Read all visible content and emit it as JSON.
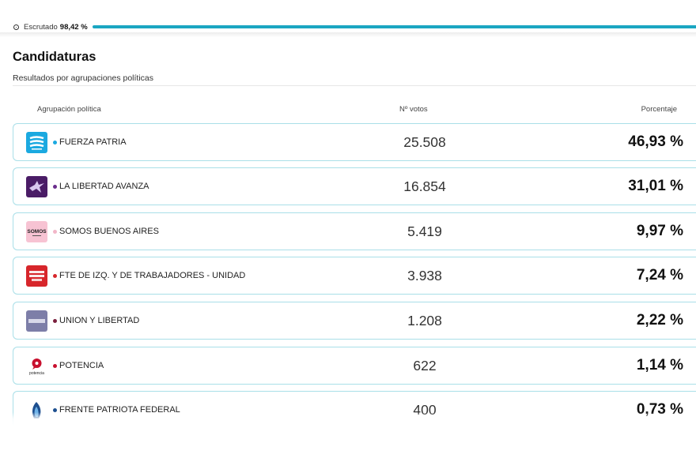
{
  "progress": {
    "label": "Escrutado",
    "value": "98,42 %",
    "fraction": 0.9842
  },
  "section": {
    "title": "Candidaturas",
    "subtitle": "Resultados por agrupaciones políticas"
  },
  "table": {
    "headers": {
      "party": "Agrupación política",
      "votes": "Nº votos",
      "percent": "Porcentaje"
    },
    "rows": [
      {
        "name": "FUERZA PATRIA",
        "votes": "25.508",
        "percent": "46,93 %",
        "color": "#1ba9e0",
        "logo_icon": "fuerza-patria-logo"
      },
      {
        "name": "LA LIBERTAD AVANZA",
        "votes": "16.854",
        "percent": "31,01 %",
        "color": "#6a2d8c",
        "logo_icon": "la-libertad-avanza-logo"
      },
      {
        "name": "SOMOS BUENOS AIRES",
        "votes": "5.419",
        "percent": "9,97 %",
        "color": "#f2b6c8",
        "logo_icon": "somos-logo",
        "logo_text": "SOMOS"
      },
      {
        "name": "FTE DE IZQ. Y DE TRABAJADORES - UNIDAD",
        "votes": "3.938",
        "percent": "7,24 %",
        "color": "#d7262b",
        "logo_icon": "fit-unidad-logo"
      },
      {
        "name": "UNION Y LIBERTAD",
        "votes": "1.208",
        "percent": "2,22 %",
        "color": "#7a1f3d",
        "logo_icon": "union-y-libertad-logo"
      },
      {
        "name": "POTENCIA",
        "votes": "622",
        "percent": "1,14 %",
        "color": "#c8102e",
        "logo_icon": "potencia-logo",
        "logo_text": "potencia"
      },
      {
        "name": "FRENTE PATRIOTA FEDERAL",
        "votes": "400",
        "percent": "0,73 %",
        "color": "#1d4f8f",
        "logo_icon": "frente-patriota-federal-logo"
      }
    ]
  }
}
